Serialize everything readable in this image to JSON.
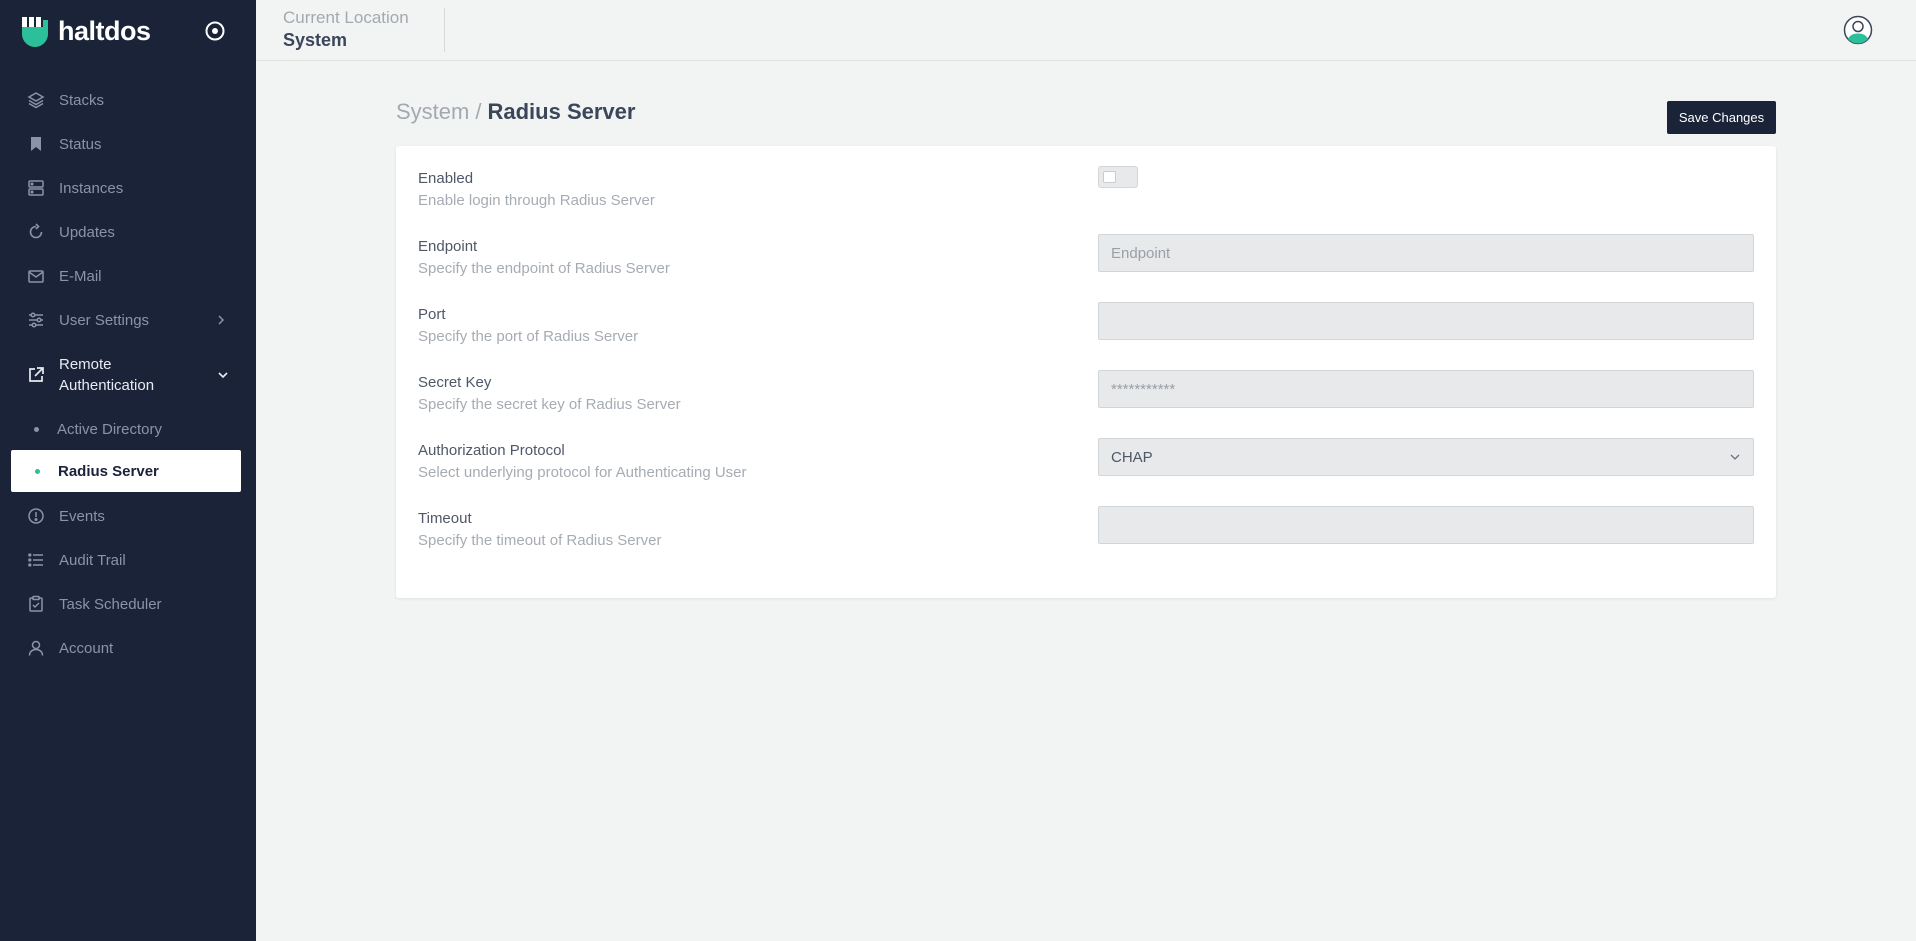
{
  "brand": {
    "name": "haltdos"
  },
  "header": {
    "location_label": "Current Location",
    "location_value": "System"
  },
  "sidebar": {
    "items": [
      {
        "label": "Stacks",
        "icon": "layers-icon"
      },
      {
        "label": "Status",
        "icon": "bookmark-icon"
      },
      {
        "label": "Instances",
        "icon": "server-icon"
      },
      {
        "label": "Updates",
        "icon": "refresh-icon"
      },
      {
        "label": "E-Mail",
        "icon": "mail-icon"
      },
      {
        "label": "User Settings",
        "icon": "sliders-icon"
      },
      {
        "label": "Remote Authentication",
        "icon": "external-link-icon"
      },
      {
        "label": "Events",
        "icon": "alert-circle-icon"
      },
      {
        "label": "Audit Trail",
        "icon": "list-icon"
      },
      {
        "label": "Task Scheduler",
        "icon": "clipboard-check-icon"
      },
      {
        "label": "Account",
        "icon": "user-icon"
      }
    ],
    "sub_items": [
      {
        "label": "Active Directory"
      },
      {
        "label": "Radius Server",
        "active": true
      }
    ]
  },
  "page": {
    "breadcrumb_parent": "System",
    "breadcrumb_separator": "/",
    "breadcrumb_current": "Radius Server",
    "save_label": "Save Changes"
  },
  "form": {
    "enabled": {
      "title": "Enabled",
      "desc": "Enable login through Radius Server",
      "value": false
    },
    "endpoint": {
      "title": "Endpoint",
      "desc": "Specify the endpoint of Radius Server",
      "placeholder": "Endpoint",
      "value": ""
    },
    "port": {
      "title": "Port",
      "desc": "Specify the port of Radius Server",
      "value": ""
    },
    "secret": {
      "title": "Secret Key",
      "desc": "Specify the secret key of Radius Server",
      "placeholder": "***********",
      "value": ""
    },
    "protocol": {
      "title": "Authorization Protocol",
      "desc": "Select underlying protocol for Authenticating User",
      "value": "CHAP"
    },
    "timeout": {
      "title": "Timeout",
      "desc": "Specify the timeout of Radius Server",
      "value": ""
    }
  },
  "colors": {
    "sidebar_bg": "#1b2338",
    "accent": "#2bbf9a",
    "background": "#f2f4f3"
  }
}
